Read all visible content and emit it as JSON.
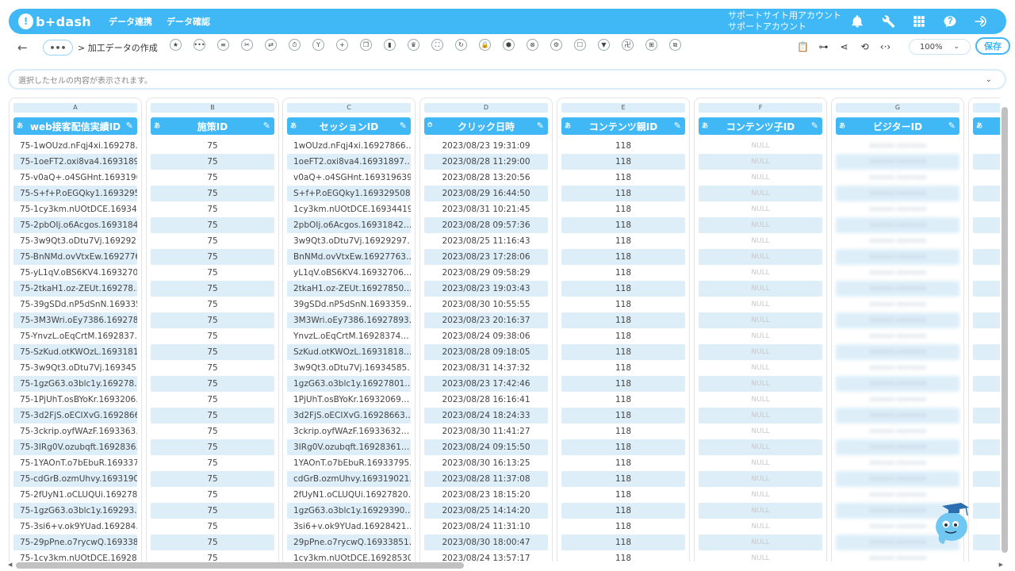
{
  "header": {
    "logo_mark": "!",
    "logo_text": "b+dash",
    "nav": [
      "データ連携",
      "データ確認"
    ],
    "account_line1": "サポートサイト用アカウント",
    "account_line2": "サポートアカウント",
    "icons": [
      "bell-icon",
      "wrench-icon",
      "grid-apps-icon",
      "help-chat-icon",
      "logout-icon"
    ]
  },
  "toolbar": {
    "back": "←",
    "more": "•••",
    "breadcrumb": "> 加工データの作成",
    "tools": [
      "★",
      "•••",
      "≡",
      "✂",
      "⇄",
      "⏱",
      "Y",
      "+",
      "❐",
      "▮",
      "♛",
      "⛶",
      "↻",
      "🔒",
      "⬢",
      "⊗",
      "⚙",
      "☐",
      "▼",
      "卍",
      "⊞",
      "⧉"
    ],
    "right_tools": [
      "📋",
      "⊶",
      "⋖",
      "⟲",
      "‹·›"
    ],
    "zoom": "100%",
    "save": "保存"
  },
  "cellbar": {
    "placeholder": "選択したセルの内容が表示されます。"
  },
  "columns": [
    {
      "letter": "A",
      "type": "あ",
      "header": "web接客配信実績ID",
      "align": "left",
      "cells": [
        "75-1wOUzd.nFqj4xi.169278…",
        "75-1oeFT2.oxi8va4.1693189…",
        "75-v0aQ+.o4SGHnt.1693196…",
        "75-S+f+P.oEGQky1.1693295…",
        "75-1cy3km.nUOtDCE.169344…",
        "75-2pbOIj.o6Acgos.1693184…",
        "75-3w9Qt3.oDtu7Vj.169292…",
        "75-BnNMd.ovVtxEw.1692776…",
        "75-yL1qV.oBS6KV4.1693270…",
        "75-2tkaH1.oz-ZEUt.169278…",
        "75-39gSDd.nP5dSnN.169335…",
        "75-3M3Wri.oEy7386.169278…",
        "75-YnvzL.oEqCrtM.1692837…",
        "75-SzKud.otKWOzL.1693181…",
        "75-3w9Qt3.oDtu7Vj.169345…",
        "75-1gzG63.o3blc1y.169278…",
        "75-1PjUhT.osBYoKr.1693206…",
        "75-3d2FjS.oECIXvG.1692866…",
        "75-3ckrip.oyfWAzF.1693363…",
        "75-3IRg0V.ozubqft.1692836…",
        "75-1YAOnT.o7bEbuR.169337…",
        "75-cdGrB.ozmUhvy.1693190…",
        "75-2fUyN1.oCLUQUi.169278…",
        "75-1gzG63.o3blc1y.169293…",
        "75-3si6+v.ok9YUad.169284…",
        "75-29pPne.o7rycwQ.169338…",
        "75-1cy3km.nUOtDCE.169285…"
      ]
    },
    {
      "letter": "B",
      "type": "あ",
      "header": "施策ID",
      "align": "center",
      "cells": [
        "75",
        "75",
        "75",
        "75",
        "75",
        "75",
        "75",
        "75",
        "75",
        "75",
        "75",
        "75",
        "75",
        "75",
        "75",
        "75",
        "75",
        "75",
        "75",
        "75",
        "75",
        "75",
        "75",
        "75",
        "75",
        "75",
        "75"
      ]
    },
    {
      "letter": "C",
      "type": "あ",
      "header": "セッションID",
      "align": "left",
      "cells": [
        "1wOUzd.nFqj4xi.16927866…",
        "1oeFT2.oxi8va4.16931897…",
        "v0aQ+.o4SGHnt.169319639…",
        "S+f+P.oEGQky1.169329508…",
        "1cy3km.nUOtDCE.16934419…",
        "2pbOIj.o6Acgos.16931842…",
        "3w9Qt3.oDtu7Vj.16929297…",
        "BnNMd.ovVtxEw.16927763…",
        "yL1qV.oBS6KV4.16932706…",
        "2tkaH1.oz-ZEUt.16927850…",
        "39gSDd.nP5dSnN.1693359…",
        "3M3Wri.oEy7386.16927893…",
        "YnvzL.oEqCrtM.16928374…",
        "SzKud.otKWOzL.16931818…",
        "3w9Qt3.oDtu7Vj.16934585…",
        "1gzG63.o3blc1y.16927801…",
        "1PjUhT.osBYoKr.16932069…",
        "3d2FjS.oECIXvG.16928663…",
        "3ckrip.oyfWAzF.16933632…",
        "3IRg0V.ozubqft.16928361…",
        "1YAOnT.o7bEbuR.16933795…",
        "cdGrB.ozmUhvy.169319021…",
        "2fUyN1.oCLUQUi.16927820…",
        "1gzG63.o3blc1y.16929390…",
        "3si6+v.ok9YUad.16928421…",
        "29pPne.o7rycwQ.16933851…",
        "1cy3km.nUOtDCE.16928530…"
      ]
    },
    {
      "letter": "D",
      "type": "⏱",
      "header": "クリック日時",
      "align": "center",
      "cells": [
        "2023/08/23 19:31:09",
        "2023/08/28 11:29:00",
        "2023/08/28 13:20:56",
        "2023/08/29 16:44:50",
        "2023/08/31 10:21:45",
        "2023/08/28 09:57:36",
        "2023/08/25 11:16:43",
        "2023/08/23 17:28:06",
        "2023/08/29 09:58:29",
        "2023/08/23 19:03:43",
        "2023/08/30 10:55:55",
        "2023/08/23 20:16:37",
        "2023/08/24 09:38:06",
        "2023/08/28 09:18:05",
        "2023/08/31 14:37:32",
        "2023/08/23 17:42:46",
        "2023/08/28 16:16:41",
        "2023/08/24 18:24:33",
        "2023/08/30 11:41:27",
        "2023/08/24 09:15:50",
        "2023/08/30 16:13:25",
        "2023/08/28 11:37:08",
        "2023/08/23 18:15:20",
        "2023/08/25 14:14:20",
        "2023/08/24 11:31:10",
        "2023/08/30 18:00:47",
        "2023/08/24 13:57:17"
      ]
    },
    {
      "letter": "E",
      "type": "あ",
      "header": "コンテンツ親ID",
      "align": "center",
      "cells": [
        "118",
        "118",
        "118",
        "118",
        "118",
        "118",
        "118",
        "118",
        "118",
        "118",
        "118",
        "118",
        "118",
        "118",
        "118",
        "118",
        "118",
        "118",
        "118",
        "118",
        "118",
        "118",
        "118",
        "118",
        "118",
        "118",
        "118"
      ]
    },
    {
      "letter": "F",
      "type": "あ",
      "header": "コンテンツ子ID",
      "align": "center",
      "cells": [
        "NULL",
        "NULL",
        "NULL",
        "NULL",
        "NULL",
        "NULL",
        "NULL",
        "NULL",
        "NULL",
        "NULL",
        "NULL",
        "NULL",
        "NULL",
        "NULL",
        "NULL",
        "NULL",
        "NULL",
        "NULL",
        "NULL",
        "NULL",
        "NULL",
        "NULL",
        "NULL",
        "NULL",
        "NULL",
        "NULL",
        "NULL"
      ]
    },
    {
      "letter": "G",
      "type": "あ",
      "header": "ビジターID",
      "align": "center",
      "cells": [
        "xxxxxx.xxxxxxx",
        "xxxxxx.xxxxxxx",
        "xxxxxx.xxxxxxx",
        "xxxxxx.xxxxxxx",
        "xxxxxx.xxxxxxx",
        "xxxxxx.xxxxxxx",
        "xxxxxx.xxxxxxx",
        "xxxxxx.xxxxxxx",
        "xxxxxx.xxxxxxx",
        "xxxxxx.xxxxxxx",
        "xxxxxx.xxxxxxx",
        "xxxxxx.xxxxxxx",
        "xxxxxx.xxxxxxx",
        "xxxxxx.xxxxxxx",
        "xxxxxx.xxxxxxx",
        "xxxxxx.xxxxxxx",
        "xxxxxx.xxxxxxx",
        "xxxxxx.xxxxxxx",
        "xxxxxx.xxxxxxx",
        "xxxxxx.xxxxxxx",
        "xxxxxx.xxxxxxx",
        "xxxxxx.xxxxxxx",
        "xxxxxx.xxxxxxx",
        "xxxxxx.xxxxxxx",
        "xxxxxx.xxxxxxx",
        "xxxxxx.xxxxxxx",
        "xxxxxx.xxxxxxx"
      ]
    },
    {
      "letter": "",
      "type": "あ",
      "header": "",
      "align": "center",
      "cells": [
        "",
        "",
        "",
        "",
        "",
        "",
        "",
        "",
        "",
        "",
        "",
        "",
        "",
        "",
        "",
        "",
        "",
        "",
        "",
        "",
        "",
        "",
        "",
        "",
        "",
        "",
        ""
      ]
    }
  ],
  "colors": {
    "brand": "#3fb8f5",
    "alt_row": "#ddeef9",
    "header_bg": "#3fb8f5"
  }
}
